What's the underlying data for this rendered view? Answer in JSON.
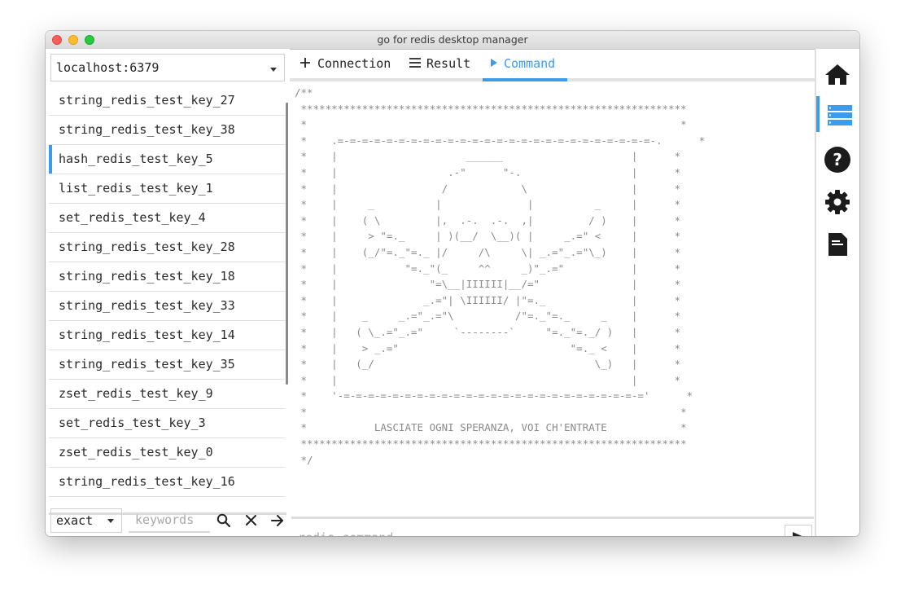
{
  "window": {
    "title": "go for redis desktop manager"
  },
  "server": {
    "selected": "localhost:6379"
  },
  "keys": [
    {
      "label": "string_redis_test_key_27"
    },
    {
      "label": "string_redis_test_key_38"
    },
    {
      "label": "hash_redis_test_key_5",
      "selected": true
    },
    {
      "label": "list_redis_test_key_1"
    },
    {
      "label": "set_redis_test_key_4"
    },
    {
      "label": "string_redis_test_key_28"
    },
    {
      "label": "string_redis_test_key_18"
    },
    {
      "label": "string_redis_test_key_33"
    },
    {
      "label": "string_redis_test_key_14"
    },
    {
      "label": "string_redis_test_key_35"
    },
    {
      "label": "zset_redis_test_key_9"
    },
    {
      "label": "set_redis_test_key_3"
    },
    {
      "label": "zset_redis_test_key_0"
    },
    {
      "label": "string_redis_test_key_16"
    }
  ],
  "filter": {
    "match_mode": "exact",
    "keywords_placeholder": "keywords"
  },
  "tabs": {
    "connection": "Connection",
    "result": "Result",
    "command": "Command",
    "active": "command"
  },
  "command": {
    "placeholder": "redis command"
  },
  "content_lines": [
    "/**",
    " ***************************************************************",
    " *                                                             *",
    " *    .=-=-=-=-=-=-=-=-=-=-=-=-=-=-=-=-=-=-=-=-=-=-=-=-=-=-.      *",
    " *    |                     ______                     |      *",
    " *    |                  .-\"      \"-.                  |      *",
    " *    |                 /            \\                 |      *",
    " *    |     _          |              |          _     |      *",
    " *    |    ( \\         |,  .-.  .-.  ,|         / )    |      *",
    " *    |     > \"=._     | )(__/  \\__)( |     _.=\" <     |      *",
    " *    |    (_/\"=._\"=._ |/     /\\     \\| _.=\"_.=\"\\_)    |      *",
    " *    |           \"=._\"(_     ^^     _)\"_.=\"           |      *",
    " *    |               \"=\\__|IIIIII|__/=\"               |      *",
    " *    |              _.=\"| \\IIIIII/ |\"=._              |      *",
    " *    |    _     _.=\"_.=\"\\          /\"=._\"=._     _    |      *",
    " *    |   ( \\_.=\"_.=\"     `--------`     \"=._\"=._/ )   |      *",
    " *    |    > _.=\"                            \"=._ <    |      *",
    " *    |   (_/                                    \\_)   |      *",
    " *    |                                                |      *",
    " *    '-=-=-=-=-=-=-=-=-=-=-=-=-=-=-=-=-=-=-=-=-=-=-=-=-='      *",
    " *                                                             *",
    " *           LASCIATE OGNI SPERANZA, VOI CH'ENTRATE            *",
    " ***************************************************************",
    " */"
  ],
  "rail": {
    "items": [
      {
        "icon": "home-icon"
      },
      {
        "icon": "list-icon",
        "active": true
      },
      {
        "icon": "help-icon"
      },
      {
        "icon": "settings-icon"
      },
      {
        "icon": "document-icon"
      }
    ]
  },
  "colors": {
    "accent": "#3d9be9",
    "text": "#222222",
    "muted": "#8a8a8a"
  }
}
